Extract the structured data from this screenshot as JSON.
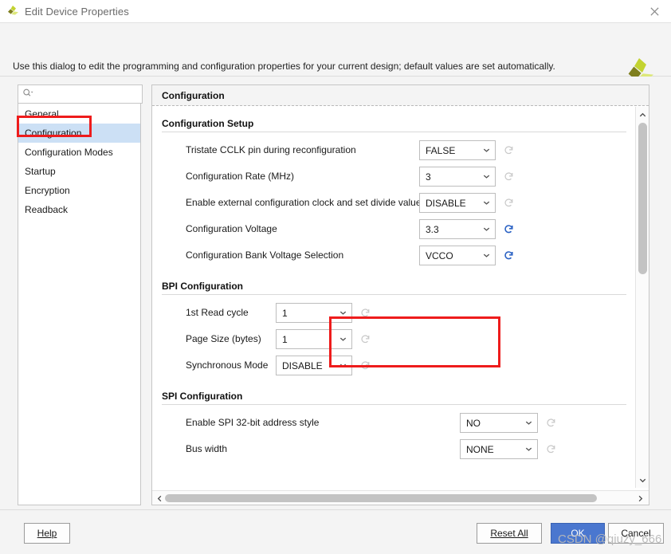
{
  "window": {
    "title": "Edit Device Properties",
    "logo_icon": "vivado-logo-icon",
    "close_icon": "close-icon"
  },
  "header": {
    "description": "Use this dialog to edit the programming and configuration properties for your current design; default values are set automatically.",
    "logo_icon": "vivado-logo-icon"
  },
  "sidebar": {
    "search": {
      "value": "",
      "placeholder": "",
      "icon": "search-icon"
    },
    "items": [
      {
        "label": "General",
        "selected": false
      },
      {
        "label": "Configuration",
        "selected": true
      },
      {
        "label": "Configuration Modes",
        "selected": false
      },
      {
        "label": "Startup",
        "selected": false
      },
      {
        "label": "Encryption",
        "selected": false
      },
      {
        "label": "Readback",
        "selected": false
      }
    ]
  },
  "panel": {
    "title": "Configuration",
    "sections": [
      {
        "heading": "Configuration Setup",
        "rows": [
          {
            "label": "Tristate CCLK pin during reconfiguration",
            "value": "FALSE",
            "reset_enabled": false,
            "highlighted": false
          },
          {
            "label": "Configuration Rate (MHz)",
            "value": "3",
            "reset_enabled": false,
            "highlighted": false
          },
          {
            "label": "Enable external configuration clock and set divide value",
            "value": "DISABLE",
            "reset_enabled": false,
            "highlighted": false
          },
          {
            "label": "Configuration Voltage",
            "value": "3.3",
            "reset_enabled": true,
            "highlighted": true
          },
          {
            "label": "Configuration Bank Voltage Selection",
            "value": "VCCO",
            "reset_enabled": true,
            "highlighted": true
          }
        ]
      },
      {
        "heading": "BPI Configuration",
        "rows": [
          {
            "label": "1st Read cycle",
            "value": "1",
            "reset_enabled": false,
            "highlighted": false
          },
          {
            "label": "Page Size (bytes)",
            "value": "1",
            "reset_enabled": false,
            "highlighted": false
          },
          {
            "label": "Synchronous Mode",
            "value": "DISABLE",
            "reset_enabled": false,
            "highlighted": false
          }
        ]
      },
      {
        "heading": "SPI Configuration",
        "rows": [
          {
            "label": "Enable SPI 32-bit address style",
            "value": "NO",
            "reset_enabled": false,
            "highlighted": false
          },
          {
            "label": "Bus width",
            "value": "NONE",
            "reset_enabled": false,
            "highlighted": false
          }
        ]
      }
    ],
    "vertical_scrollbar": {
      "up_icon": "chevron-up-icon",
      "down_icon": "chevron-down-icon"
    },
    "horizontal_scrollbar": {
      "left_icon": "chevron-left-icon",
      "right_icon": "chevron-right-icon"
    }
  },
  "footer": {
    "help_label": "Help",
    "reset_all_label": "Reset All",
    "ok_label": "OK",
    "cancel_label": "Cancel"
  },
  "watermark": {
    "text": "CSDN @qiuzy_666"
  },
  "colors": {
    "accent_blue": "#4a77cf",
    "selection_blue": "#cce0f5",
    "highlight_red": "#ee1c1c",
    "reset_active_blue": "#2b62c4",
    "reset_disabled_gray": "#c8c8c8",
    "logo_olive": "#7f7f1e",
    "logo_green": "#c3d330",
    "logo_light": "#dde87a"
  }
}
